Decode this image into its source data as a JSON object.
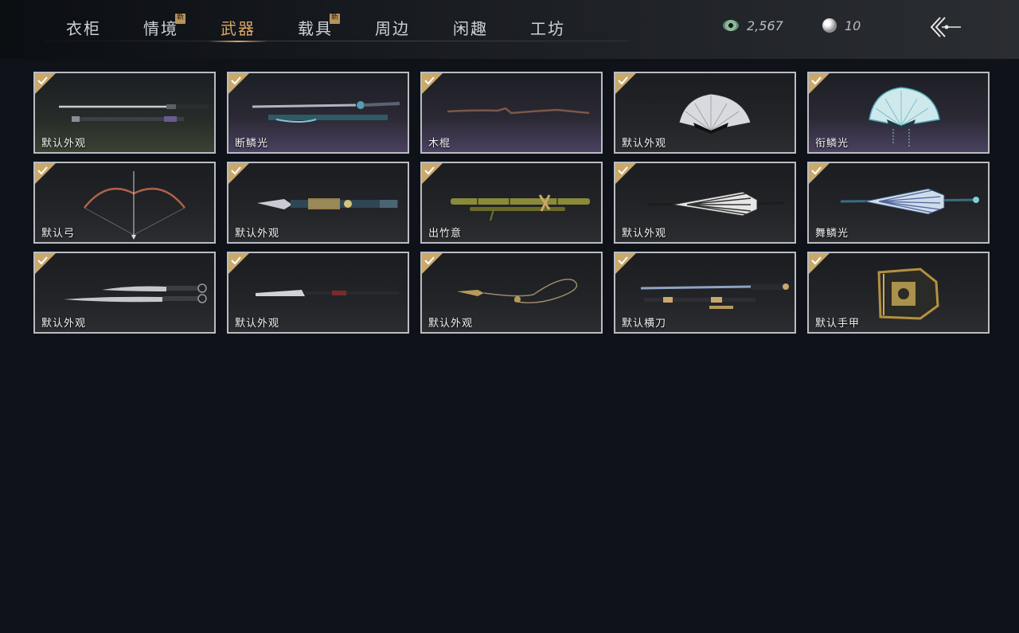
{
  "tabs": [
    {
      "label": "衣柜",
      "badge": ""
    },
    {
      "label": "情境",
      "badge": "新"
    },
    {
      "label": "武器",
      "badge": ""
    },
    {
      "label": "载具",
      "badge": "新"
    },
    {
      "label": "周边",
      "badge": ""
    },
    {
      "label": "闲趣",
      "badge": ""
    },
    {
      "label": "工坊",
      "badge": ""
    }
  ],
  "active_tab": "武器",
  "currency": {
    "jade": {
      "icon": "jade-coin-icon",
      "value": "2,567"
    },
    "pearl": {
      "icon": "pearl-icon",
      "value": "10"
    }
  },
  "back_icon": "back-arrow-icon",
  "items": [
    {
      "name": "默认外观",
      "art": "sword-pair",
      "owned": true
    },
    {
      "name": "断鳞光",
      "art": "ornate-sword",
      "owned": true
    },
    {
      "name": "木棍",
      "art": "wooden-stick",
      "owned": true
    },
    {
      "name": "默认外观",
      "art": "folding-fan",
      "owned": true
    },
    {
      "name": "衔鳞光",
      "art": "jade-fan",
      "owned": true
    },
    {
      "name": "默认弓",
      "art": "bow",
      "owned": true
    },
    {
      "name": "默认外观",
      "art": "blade-spear",
      "owned": true
    },
    {
      "name": "出竹意",
      "art": "bamboo-staff",
      "owned": true
    },
    {
      "name": "默认外观",
      "art": "umbrella",
      "owned": true
    },
    {
      "name": "舞鳞光",
      "art": "jade-umbrella",
      "owned": true
    },
    {
      "name": "默认外观",
      "art": "twin-blades",
      "owned": true
    },
    {
      "name": "默认外观",
      "art": "glaive",
      "owned": true
    },
    {
      "name": "默认外观",
      "art": "rope-dart",
      "owned": true
    },
    {
      "name": "默认横刀",
      "art": "hengdao",
      "owned": true
    },
    {
      "name": "默认手甲",
      "art": "gauntlet",
      "owned": true
    }
  ],
  "colors": {
    "active_tab": "#d9a968",
    "check_badge": "#c9a86a",
    "card_border": "#b9bcc1"
  }
}
